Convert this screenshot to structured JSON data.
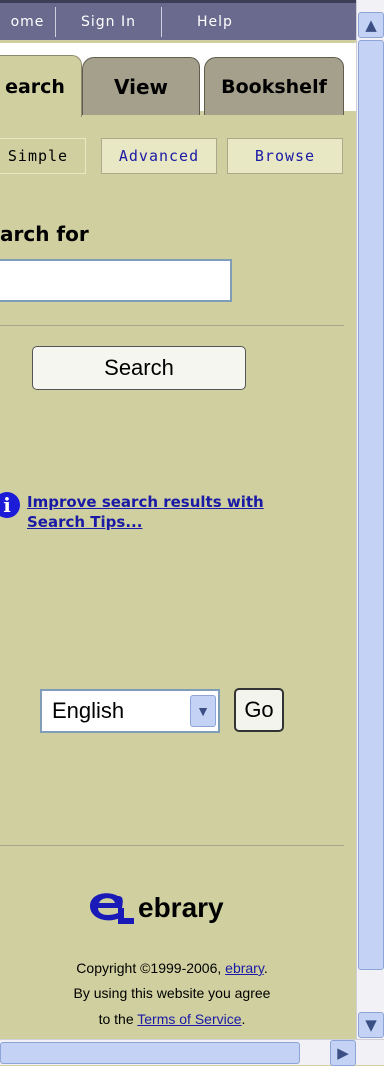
{
  "topnav": {
    "items": [
      "ome",
      "Sign In",
      "Help"
    ]
  },
  "tabs": [
    {
      "label": "earch",
      "active": true
    },
    {
      "label": "View",
      "active": false
    },
    {
      "label": "Bookshelf",
      "active": false
    }
  ],
  "subnav": [
    {
      "label": "Simple",
      "active": true
    },
    {
      "label": "Advanced",
      "active": false
    },
    {
      "label": "Browse",
      "active": false
    }
  ],
  "search": {
    "heading": "arch for",
    "input_value": "",
    "button_label": "Search"
  },
  "tips": {
    "icon": "info-icon",
    "link_line1": "Improve search results with",
    "link_line2": "Search Tips..."
  },
  "language": {
    "selected": "English",
    "go_label": "Go"
  },
  "footer": {
    "logo_text": "ebrary",
    "copyright_prefix": "Copyright ©1999-2006,",
    "copyright_link": "ebrary",
    "copyright_suffix": ".",
    "line2": "By using this website you agree",
    "line3_prefix": "to the",
    "terms_link": "Terms of Service",
    "line3_suffix": "."
  },
  "colors": {
    "panel_bg": "#cfcf9f",
    "nav_bg": "#6a6a8e",
    "tab_inactive": "#a4a08c",
    "link": "#1a1aa6",
    "logo_blue": "#1a1ab8"
  }
}
